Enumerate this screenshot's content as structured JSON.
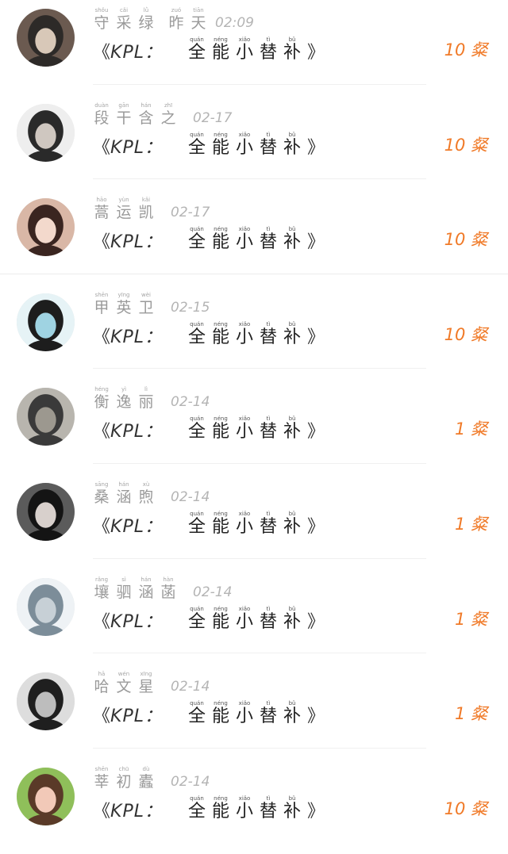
{
  "list": {
    "title_parts": {
      "open_bracket": "《",
      "prefix": "KPL：",
      "chars": [
        {
          "py": "quán",
          "ch": "全"
        },
        {
          "py": "néng",
          "ch": "能"
        },
        {
          "py": "xiǎo",
          "ch": "小"
        },
        {
          "py": "tì",
          "ch": "替"
        },
        {
          "py": "bǔ",
          "ch": "补"
        }
      ],
      "close_bracket": "》"
    },
    "items": [
      {
        "name": [
          {
            "py": "shǒu",
            "ch": "守"
          },
          {
            "py": "cǎi",
            "ch": "采"
          },
          {
            "py": "lǜ",
            "ch": "绿"
          }
        ],
        "time_ruby": [
          {
            "py": "zuó",
            "ch": "昨"
          },
          {
            "py": "tiān",
            "ch": "天"
          }
        ],
        "time": "02:09",
        "count": "10 粲",
        "avatar_colors": [
          "#6b5a50",
          "#2d2a28",
          "#d8c8b8"
        ]
      },
      {
        "name": [
          {
            "py": "duàn",
            "ch": "段"
          },
          {
            "py": "gān",
            "ch": "干"
          },
          {
            "py": "hán",
            "ch": "含"
          },
          {
            "py": "zhī",
            "ch": "之"
          }
        ],
        "time_ruby": [],
        "time": "02-17",
        "count": "10 粲",
        "avatar_colors": [
          "#eeeeee",
          "#2a2a2a",
          "#cfc7c0"
        ]
      },
      {
        "name": [
          {
            "py": "hāo",
            "ch": "蒿"
          },
          {
            "py": "yùn",
            "ch": "运"
          },
          {
            "py": "kǎi",
            "ch": "凯"
          }
        ],
        "time_ruby": [],
        "time": "02-17",
        "count": "10 粲",
        "avatar_colors": [
          "#d9b7a6",
          "#3a2520",
          "#f3d9cc"
        ]
      },
      {
        "name": [
          {
            "py": "shēn",
            "ch": "甲"
          },
          {
            "py": "yīng",
            "ch": "英"
          },
          {
            "py": "wèi",
            "ch": "卫"
          }
        ],
        "time_ruby": [],
        "time": "02-15",
        "count": "10 粲",
        "avatar_colors": [
          "#e6f3f6",
          "#1d1d1d",
          "#9fd3e2"
        ]
      },
      {
        "name": [
          {
            "py": "héng",
            "ch": "衡"
          },
          {
            "py": "yì",
            "ch": "逸"
          },
          {
            "py": "lì",
            "ch": "丽"
          }
        ],
        "time_ruby": [],
        "time": "02-14",
        "count": "1 粲",
        "avatar_colors": [
          "#b8b5ae",
          "#3a3a3a",
          "#9c988f"
        ]
      },
      {
        "name": [
          {
            "py": "sāng",
            "ch": "桑"
          },
          {
            "py": "hán",
            "ch": "涵"
          },
          {
            "py": "xù",
            "ch": "煦"
          }
        ],
        "time_ruby": [],
        "time": "02-14",
        "count": "1 粲",
        "avatar_colors": [
          "#5b5b5b",
          "#141414",
          "#d8d0cc"
        ]
      },
      {
        "name": [
          {
            "py": "rǎng",
            "ch": "壤"
          },
          {
            "py": "sì",
            "ch": "驷"
          },
          {
            "py": "hán",
            "ch": "涵"
          },
          {
            "py": "hàn",
            "ch": "菡"
          }
        ],
        "time_ruby": [],
        "time": "02-14",
        "count": "1 粲",
        "avatar_colors": [
          "#eef2f5",
          "#7c8d99",
          "#c7d0d6"
        ]
      },
      {
        "name": [
          {
            "py": "hā",
            "ch": "哈"
          },
          {
            "py": "wén",
            "ch": "文"
          },
          {
            "py": "xīng",
            "ch": "星"
          }
        ],
        "time_ruby": [],
        "time": "02-14",
        "count": "1 粲",
        "avatar_colors": [
          "#dddddd",
          "#1f1f1f",
          "#bdbdbd"
        ]
      },
      {
        "name": [
          {
            "py": "shēn",
            "ch": "莘"
          },
          {
            "py": "chū",
            "ch": "初"
          },
          {
            "py": "dù",
            "ch": "蠹"
          }
        ],
        "time_ruby": [],
        "time": "02-14",
        "count": "10 粲",
        "avatar_colors": [
          "#8fbf5a",
          "#5a3a28",
          "#f2c9b8"
        ]
      }
    ]
  }
}
